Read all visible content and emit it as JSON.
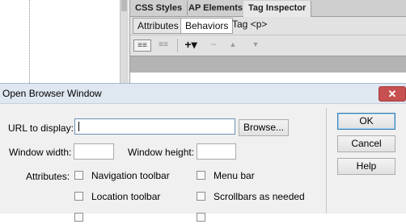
{
  "panel": {
    "tabs": [
      "CSS Styles",
      "AP Elements",
      "Tag Inspector"
    ],
    "subtabs": [
      "Attributes",
      "Behaviors"
    ],
    "tag_label": "Tag <p>",
    "toolbar": {
      "show_set_icon": "≡≡",
      "show_all_icon": "≡≡",
      "add_icon": "+▾",
      "remove_icon": "−",
      "up_icon": "▲",
      "down_icon": "▼"
    }
  },
  "dialog": {
    "title": "Open Browser Window",
    "close_glyph": "✕",
    "url_label": "URL to display:",
    "url_value": "",
    "browse_label": "Browse...",
    "width_label": "Window width:",
    "width_value": "",
    "height_label": "Window height:",
    "height_value": "",
    "attributes_label": "Attributes:",
    "checkboxes": [
      {
        "label": "Navigation toolbar",
        "checked": false
      },
      {
        "label": "Menu bar",
        "checked": false
      },
      {
        "label": "Location toolbar",
        "checked": false
      },
      {
        "label": "Scrollbars as needed",
        "checked": false
      },
      {
        "label": "",
        "checked": false
      },
      {
        "label": "",
        "checked": false
      }
    ],
    "ok_label": "OK",
    "cancel_label": "Cancel",
    "help_label": "Help"
  }
}
